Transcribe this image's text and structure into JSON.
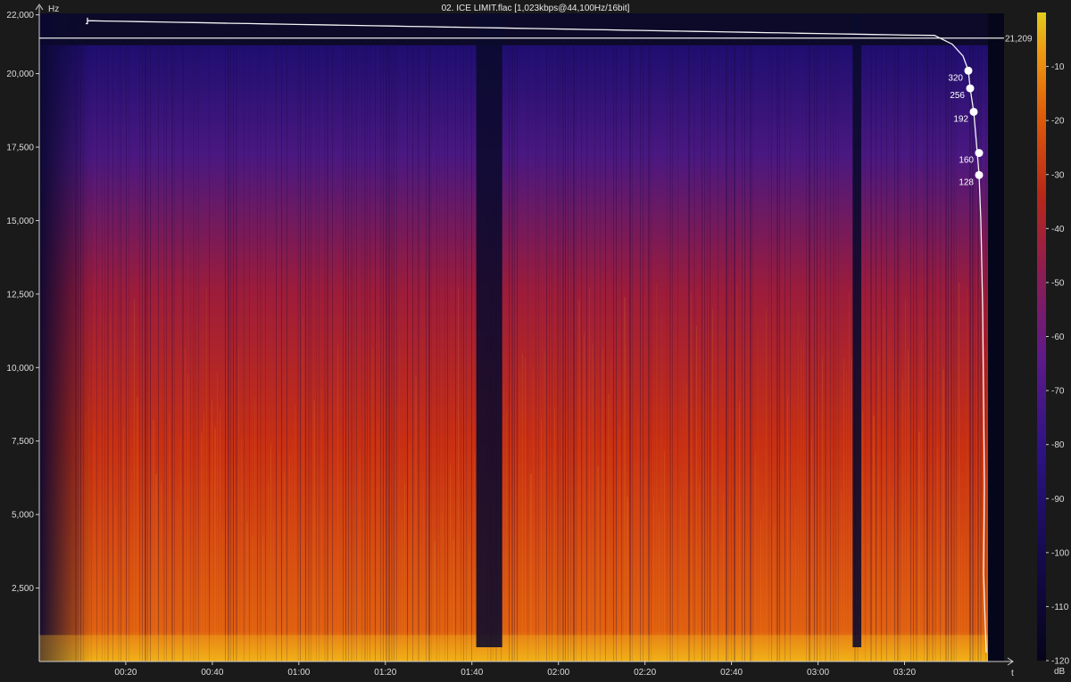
{
  "chart_data": {
    "type": "heatmap",
    "title": "02. ICE LIMIT.flac [1,023kbps@44,100Hz/16bit]",
    "y_unit": "Hz",
    "x_unit": "t",
    "colorbar_unit": "dB",
    "y_ticks": [
      "22,000",
      "20,000",
      "17,500",
      "15,000",
      "12,500",
      "10,000",
      "7,500",
      "5,000",
      "2,500"
    ],
    "y_tick_values": [
      22000,
      20000,
      17500,
      15000,
      12500,
      10000,
      7500,
      5000,
      2500
    ],
    "ylim": [
      0,
      22050
    ],
    "x_ticks": [
      "00:20",
      "00:40",
      "01:00",
      "01:20",
      "01:40",
      "02:00",
      "02:20",
      "02:40",
      "03:00",
      "03:20"
    ],
    "x_tick_seconds": [
      20,
      40,
      60,
      80,
      100,
      120,
      140,
      160,
      180,
      200
    ],
    "xlim_seconds": [
      0,
      223
    ],
    "colorbar_ticks": [
      "-10",
      "-20",
      "-30",
      "-40",
      "-50",
      "-60",
      "-70",
      "-80",
      "-90",
      "-100",
      "-110",
      "-120"
    ],
    "colorbar_values": [
      -10,
      -20,
      -30,
      -40,
      -50,
      -60,
      -70,
      -80,
      -90,
      -100,
      -110,
      -120
    ],
    "colorbar_range": [
      -120,
      0
    ],
    "cutoff_line": {
      "label": "21,209",
      "value": 21209
    },
    "bitrate_markers": [
      {
        "label": "320",
        "freq": 20100
      },
      {
        "label": "256",
        "freq": 19500
      },
      {
        "label": "192",
        "freq": 18700
      },
      {
        "label": "160",
        "freq": 17300
      },
      {
        "label": "128",
        "freq": 16550
      }
    ],
    "colormap": [
      "#07061a",
      "#1a0c5e",
      "#3a1690",
      "#6a1a7a",
      "#9a1e2e",
      "#c43a10",
      "#e26808",
      "#f2a010",
      "#e8c81a"
    ],
    "grid": false,
    "legend": "colorbar-right"
  }
}
